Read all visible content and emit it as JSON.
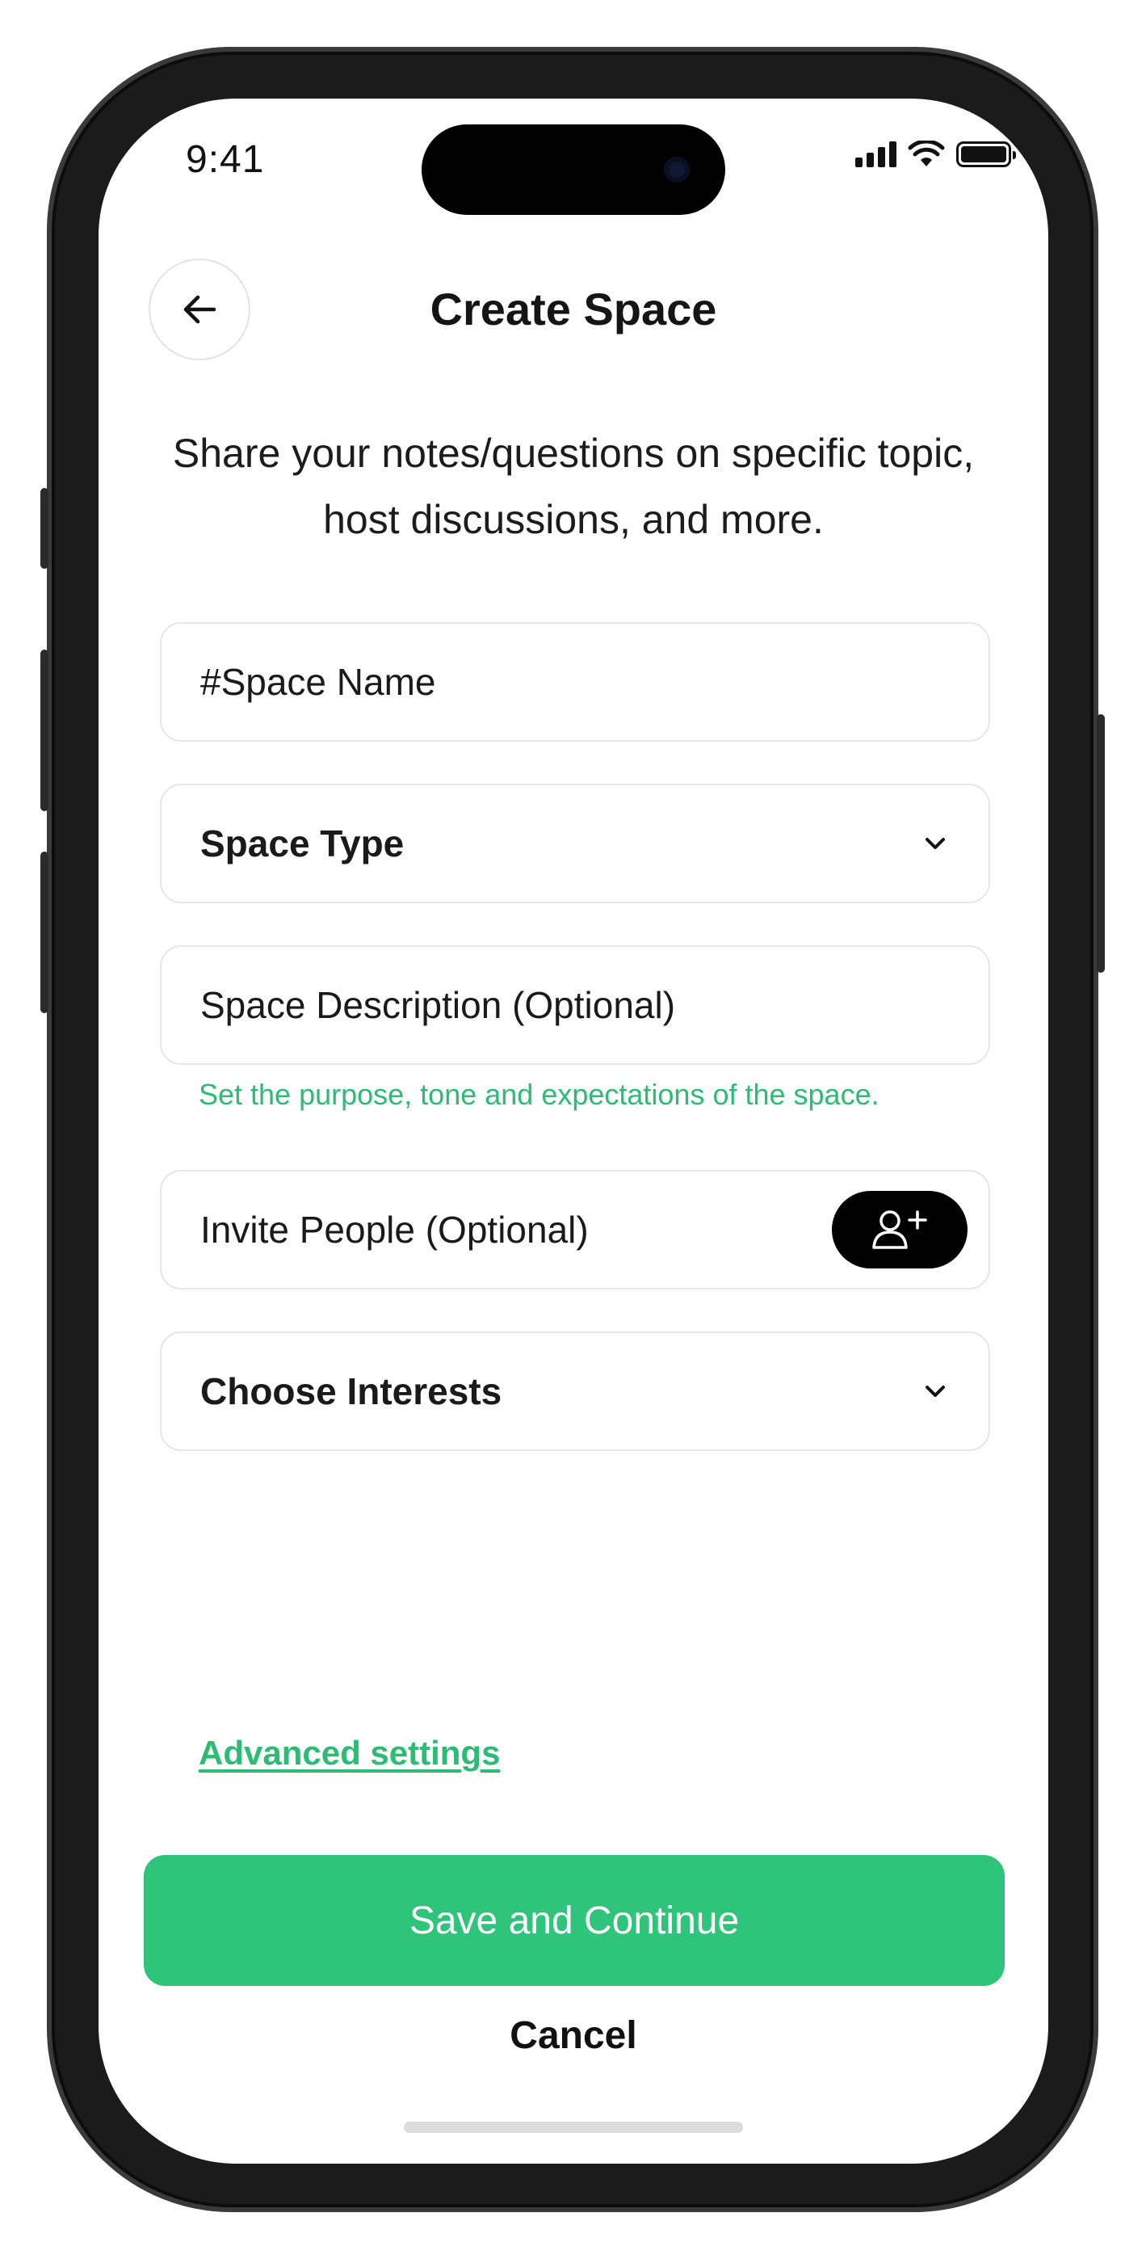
{
  "status_bar": {
    "time": "9:41",
    "icons": [
      "signal-icon",
      "wifi-icon",
      "battery-icon"
    ]
  },
  "header": {
    "back_icon": "arrow-left-icon",
    "title": "Create Space",
    "subtitle": "Share your notes/questions on specific topic, host discussions, and more."
  },
  "form": {
    "space_name_placeholder": "#Space Name",
    "space_type_label": "Space Type",
    "space_description_placeholder": "Space Description (Optional)",
    "description_helper": "Set the purpose, tone and expectations of the space.",
    "invite_label": "Invite People (Optional)",
    "invite_icon": "add-user-icon",
    "interests_label": "Choose Interests"
  },
  "footer": {
    "advanced_settings": "Advanced settings",
    "save_button": "Save and Continue",
    "cancel_button": "Cancel"
  },
  "colors": {
    "accent": "#2ec47a",
    "accent_text": "#2bbd74",
    "text": "#151515",
    "border": "#e6e6e6",
    "device_frame": "#1b1b1b"
  }
}
